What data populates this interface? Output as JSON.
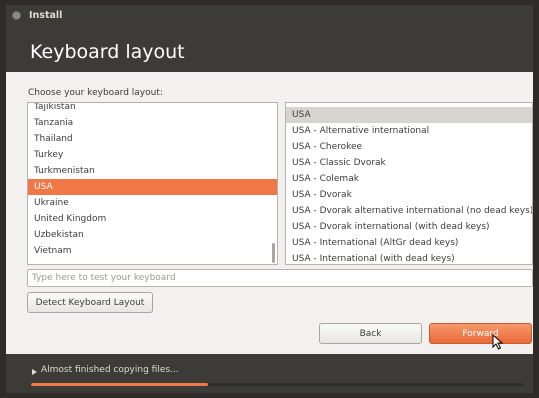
{
  "window": {
    "title": "Install"
  },
  "header": {
    "title": "Keyboard layout"
  },
  "prompt": "Choose your keyboard layout:",
  "layouts": {
    "items": [
      "Tajikistan",
      "Tanzania",
      "Thailand",
      "Turkey",
      "Turkmenistan",
      "USA",
      "Ukraine",
      "United Kingdom",
      "Uzbekistan",
      "Vietnam"
    ],
    "selected": "USA"
  },
  "variants": {
    "items": [
      "USA",
      "USA - Alternative international",
      "USA - Cherokee",
      "USA - Classic Dvorak",
      "USA - Colemak",
      "USA - Dvorak",
      "USA - Dvorak alternative international (no dead keys)",
      "USA - Dvorak international (with dead keys)",
      "USA - International (AltGr dead keys)",
      "USA - International (with dead keys)"
    ],
    "selected": "USA"
  },
  "test_input": {
    "placeholder": "Type here to test your keyboard",
    "value": ""
  },
  "buttons": {
    "detect": "Detect Keyboard Layout",
    "back": "Back",
    "forward": "Forward"
  },
  "footer": {
    "status": "Almost finished copying files...",
    "progress": 0.36
  },
  "colors": {
    "accent": "#f07746",
    "dark": "#3c3b37",
    "background": "#f2f1f0"
  }
}
